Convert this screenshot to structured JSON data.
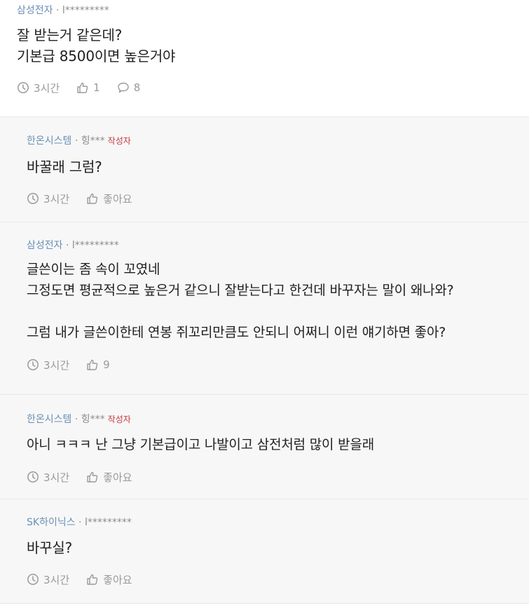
{
  "comments": [
    {
      "company": "삼성전자",
      "sep": " · ",
      "author": "l*********",
      "author_badge": "",
      "body": "잘 받는거 같은데?\n기본급 8500이면 높은거야",
      "time": "3시간",
      "likes": "1",
      "replies": "8"
    },
    {
      "company": "한온시스템",
      "sep": " · ",
      "author": "힝***",
      "author_badge": "작성자",
      "body": "바꿀래 그럼?",
      "time": "3시간",
      "likes": "좋아요"
    },
    {
      "company": "삼성전자",
      "sep": " · ",
      "author": "l*********",
      "author_badge": "",
      "body": "글쓴이는 좀 속이 꼬였네\n그정도면 평균적으로 높은거 같으니 잘받는다고 한건데 바꾸자는 말이 왜나와?\n\n그럼 내가 글쓴이한테 연봉 쥐꼬리만큼도 안되니 어쩌니 이런 얘기하면 좋아?",
      "time": "3시간",
      "likes": "9"
    },
    {
      "company": "한온시스템",
      "sep": " · ",
      "author": "힝***",
      "author_badge": "작성자",
      "body": "아니 ㅋㅋㅋ 난 그냥 기본급이고 나발이고 삼전처럼 많이 받을래",
      "time": "3시간",
      "likes": "좋아요"
    },
    {
      "company": "SK하이닉스",
      "sep": " · ",
      "author": "l*********",
      "author_badge": "",
      "body": "바꾸실?",
      "time": "3시간",
      "likes": "좋아요"
    }
  ],
  "icons": {
    "time": "clock-icon",
    "like": "thumbs-up-icon",
    "reply": "speech-bubble-icon"
  },
  "colors": {
    "company": "#6b90b4",
    "author_badge": "#c9353f",
    "reply_background": "#f7f7f8",
    "meta_gray": "#8c8c8c"
  }
}
